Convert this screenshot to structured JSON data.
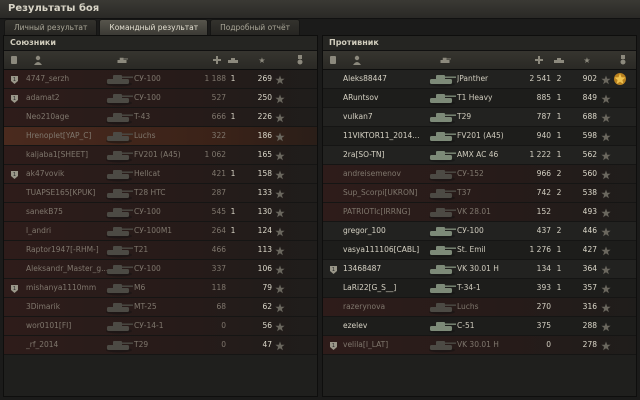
{
  "window": {
    "title": "Результаты боя"
  },
  "tabs": [
    {
      "label": "Личный результат",
      "active": false
    },
    {
      "label": "Командный результат",
      "active": true
    },
    {
      "label": "Подробный отчёт",
      "active": false
    }
  ],
  "allies": {
    "title": "Союзники",
    "rows": [
      {
        "player": "4747_serzh",
        "vehicle": "СУ-100",
        "damage": "1 188",
        "frags": "1",
        "xp": "269",
        "platoon": true,
        "dead": true
      },
      {
        "player": "adamat2",
        "vehicle": "СУ-100",
        "damage": "527",
        "frags": "",
        "xp": "250",
        "platoon": true,
        "dead": true
      },
      {
        "player": "Neo210age",
        "vehicle": "T-43",
        "damage": "666",
        "frags": "1",
        "xp": "226",
        "platoon": false,
        "dead": true
      },
      {
        "player": "Hrenoplet[YAP_C]",
        "vehicle": "Luchs",
        "damage": "322",
        "frags": "",
        "xp": "186",
        "platoon": false,
        "dead": true,
        "self": true
      },
      {
        "player": "kaljaba1[SHEET]",
        "vehicle": "FV201 (A45)",
        "damage": "1 062",
        "frags": "",
        "xp": "165",
        "platoon": false,
        "dead": true
      },
      {
        "player": "ak47vovik",
        "vehicle": "Hellcat",
        "damage": "421",
        "frags": "1",
        "xp": "158",
        "platoon": true,
        "dead": true
      },
      {
        "player": "TUAPSE165[KPUK]",
        "vehicle": "T28 HTC",
        "damage": "287",
        "frags": "",
        "xp": "133",
        "platoon": false,
        "dead": true
      },
      {
        "player": "sanekB75",
        "vehicle": "СУ-100",
        "damage": "545",
        "frags": "1",
        "xp": "130",
        "platoon": false,
        "dead": true
      },
      {
        "player": "l_andri",
        "vehicle": "СУ-100М1",
        "damage": "264",
        "frags": "1",
        "xp": "124",
        "platoon": false,
        "dead": true
      },
      {
        "player": "Raptor1947[-RHM-]",
        "vehicle": "T21",
        "damage": "466",
        "frags": "",
        "xp": "113",
        "platoon": false,
        "dead": true
      },
      {
        "player": "Aleksandr_Master_g...",
        "vehicle": "СУ-100",
        "damage": "337",
        "frags": "",
        "xp": "106",
        "platoon": false,
        "dead": true
      },
      {
        "player": "mishanya1110mm",
        "vehicle": "M6",
        "damage": "118",
        "frags": "",
        "xp": "79",
        "platoon": true,
        "dead": true
      },
      {
        "player": "3Dimarik",
        "vehicle": "MT-25",
        "damage": "68",
        "frags": "",
        "xp": "62",
        "platoon": false,
        "dead": true
      },
      {
        "player": "wor0101[FI]",
        "vehicle": "СУ-14-1",
        "damage": "0",
        "frags": "",
        "xp": "56",
        "platoon": false,
        "dead": true
      },
      {
        "player": "_rf_2014",
        "vehicle": "T29",
        "damage": "0",
        "frags": "",
        "xp": "47",
        "platoon": false,
        "dead": true
      }
    ]
  },
  "enemies": {
    "title": "Противник",
    "rows": [
      {
        "player": "Aleks88447",
        "vehicle": "JPanther",
        "damage": "2 541",
        "frags": "2",
        "xp": "902",
        "platoon": false,
        "dead": false,
        "medal": true
      },
      {
        "player": "ARuntsov",
        "vehicle": "T1 Heavy",
        "damage": "885",
        "frags": "1",
        "xp": "849",
        "platoon": false,
        "dead": false
      },
      {
        "player": "vulkan7",
        "vehicle": "T29",
        "damage": "787",
        "frags": "1",
        "xp": "688",
        "platoon": false,
        "dead": false
      },
      {
        "player": "11VIKTOR11_2014...",
        "vehicle": "FV201 (A45)",
        "damage": "940",
        "frags": "1",
        "xp": "598",
        "platoon": false,
        "dead": false
      },
      {
        "player": "2ra[SO-TN]",
        "vehicle": "AMX AC 46",
        "damage": "1 222",
        "frags": "1",
        "xp": "562",
        "platoon": false,
        "dead": false
      },
      {
        "player": "andreisemenov",
        "vehicle": "СУ-152",
        "damage": "966",
        "frags": "2",
        "xp": "560",
        "platoon": false,
        "dead": true
      },
      {
        "player": "Sup_Scorpi[UKRON]",
        "vehicle": "T37",
        "damage": "742",
        "frags": "2",
        "xp": "538",
        "platoon": false,
        "dead": true
      },
      {
        "player": "PATRIOTIc[IRRNG]",
        "vehicle": "VK 28.01",
        "damage": "152",
        "frags": "",
        "xp": "493",
        "platoon": false,
        "dead": true
      },
      {
        "player": "gregor_100",
        "vehicle": "СУ-100",
        "damage": "437",
        "frags": "2",
        "xp": "446",
        "platoon": false,
        "dead": false
      },
      {
        "player": "vasya111106[CABL]",
        "vehicle": "St. Emil",
        "damage": "1 276",
        "frags": "1",
        "xp": "427",
        "platoon": false,
        "dead": false
      },
      {
        "player": "13468487",
        "vehicle": "VK 30.01 H",
        "damage": "134",
        "frags": "1",
        "xp": "364",
        "platoon": true,
        "dead": false
      },
      {
        "player": "LaRi22[G_S__]",
        "vehicle": "T-34-1",
        "damage": "393",
        "frags": "1",
        "xp": "357",
        "platoon": false,
        "dead": false
      },
      {
        "player": "razerynova",
        "vehicle": "Luchs",
        "damage": "270",
        "frags": "",
        "xp": "316",
        "platoon": false,
        "dead": true
      },
      {
        "player": "ezelev",
        "vehicle": "C-51",
        "damage": "375",
        "frags": "",
        "xp": "288",
        "platoon": false,
        "dead": false
      },
      {
        "player": "velila[I_LAT]",
        "vehicle": "VK 30.01 H",
        "damage": "0",
        "frags": "",
        "xp": "278",
        "platoon": true,
        "dead": true
      }
    ]
  }
}
